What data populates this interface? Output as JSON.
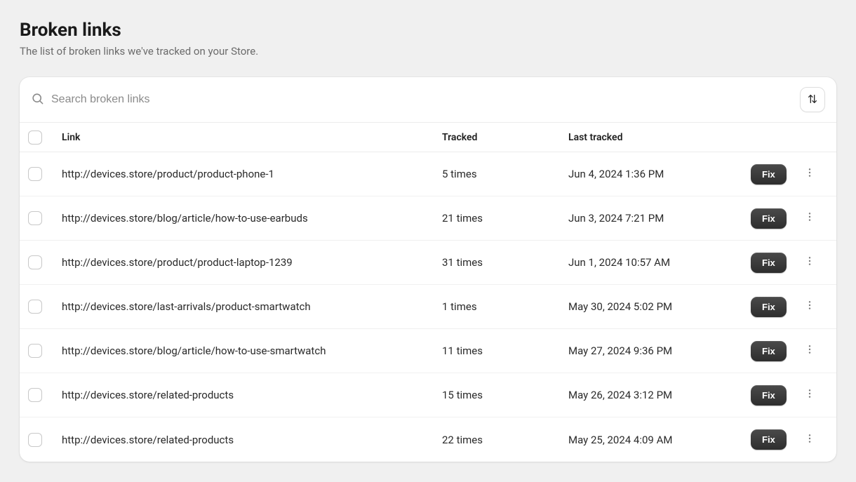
{
  "header": {
    "title": "Broken links",
    "subtitle": "The list of broken links we've tracked on your Store."
  },
  "search": {
    "placeholder": "Search broken links"
  },
  "table": {
    "columns": {
      "link": "Link",
      "tracked": "Tracked",
      "last_tracked": "Last tracked"
    },
    "fix_label": "Fix",
    "rows": [
      {
        "link": "http://devices.store/product/product-phone-1",
        "tracked": "5 times",
        "last_tracked": "Jun 4, 2024 1:36 PM"
      },
      {
        "link": "http://devices.store/blog/article/how-to-use-earbuds",
        "tracked": "21 times",
        "last_tracked": "Jun 3, 2024 7:21 PM"
      },
      {
        "link": "http://devices.store/product/product-laptop-1239",
        "tracked": "31 times",
        "last_tracked": "Jun 1, 2024 10:57 AM"
      },
      {
        "link": "http://devices.store/last-arrivals/product-smartwatch",
        "tracked": "1 times",
        "last_tracked": "May 30, 2024 5:02 PM"
      },
      {
        "link": "http://devices.store/blog/article/how-to-use-smartwatch",
        "tracked": "11 times",
        "last_tracked": "May 27, 2024 9:36 PM"
      },
      {
        "link": "http://devices.store/related-products",
        "tracked": "15 times",
        "last_tracked": "May 26, 2024 3:12 PM"
      },
      {
        "link": "http://devices.store/related-products",
        "tracked": "22 times",
        "last_tracked": "May 25, 2024 4:09 AM"
      }
    ]
  }
}
